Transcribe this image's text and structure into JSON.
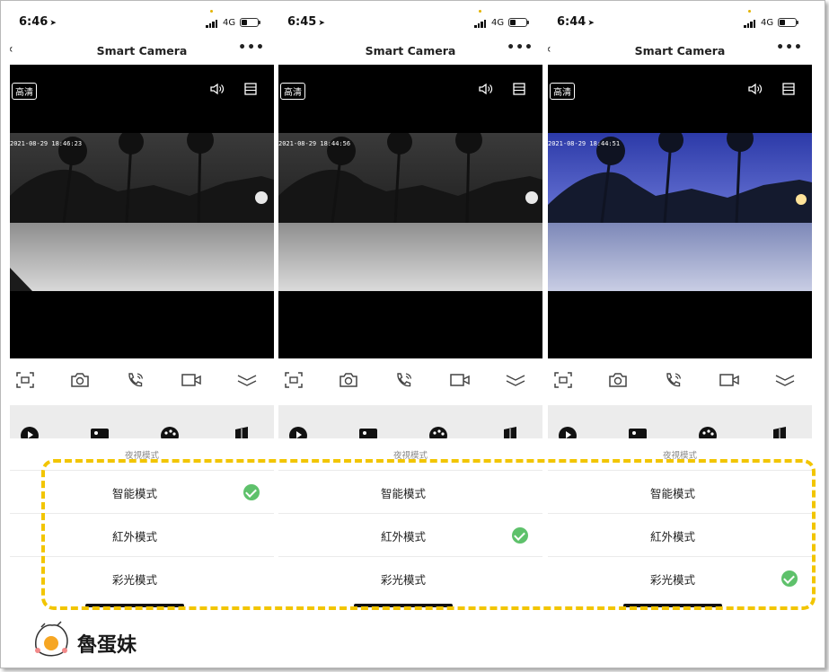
{
  "app": {
    "title": "Smart Camera",
    "more_label": "•••",
    "back_label": "‹",
    "hd_label": "高清",
    "network": "4G",
    "night_mode_title": "夜視模式",
    "modes": [
      "智能模式",
      "紅外模式",
      "彩光模式"
    ],
    "colors": {
      "check": "#5ec16b",
      "highlight": "#f2c500",
      "battery_dot": "#e3b300"
    }
  },
  "screens": [
    {
      "time": "6:46",
      "timestamp": "2021-08-29 18:46:23",
      "selected_mode": "智能模式",
      "image": "black-and-white night view"
    },
    {
      "time": "6:45",
      "timestamp": "2021-08-29 18:44:56",
      "selected_mode": "紅外模式",
      "image": "black-and-white night view"
    },
    {
      "time": "6:44",
      "timestamp": "2021-08-29 18:44:51",
      "selected_mode": "彩光模式",
      "image": "color dusk view"
    }
  ],
  "controls": [
    "screenshot-frame-icon",
    "camera-icon",
    "phone-call-icon",
    "video-record-icon",
    "collapse-chevron-icon"
  ],
  "watermark": {
    "text": "魯蛋妹"
  }
}
